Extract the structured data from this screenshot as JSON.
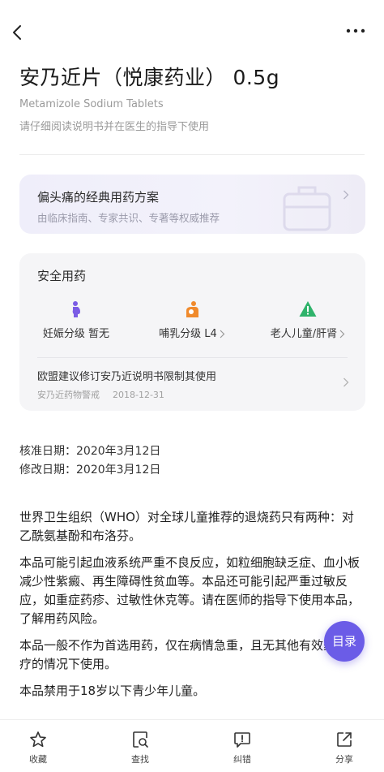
{
  "header": {
    "back_icon": "chevron-left-icon",
    "more_icon": "more-dots-icon"
  },
  "drug": {
    "title": "安乃近片（悦康药业） 0.5g",
    "english_name": "Metamizole Sodium Tablets",
    "instruction": "请仔细阅读说明书并在医生的指导下使用"
  },
  "migraine_card": {
    "title": "偏头痛的经典用药方案",
    "desc": "由临床指南、专家共识、专著等权威推荐"
  },
  "safety": {
    "title": "安全用药",
    "items": [
      {
        "label": "妊娠分级 暂无",
        "icon": "pregnancy-icon",
        "color": "#7b5ce5"
      },
      {
        "label": "哺乳分级 L4",
        "icon": "breastfeeding-icon",
        "color": "#f08a2c"
      },
      {
        "label": "老人儿童/肝肾",
        "icon": "warning-triangle-icon",
        "color": "#2fb36b"
      }
    ],
    "warning": {
      "title": "欧盟建议修订安乃近说明书限制其使用",
      "source": "安乃近药物警戒",
      "date": "2018-12-31"
    }
  },
  "dates": {
    "approved": "核准日期：2020年3月12日",
    "revised": "修改日期：2020年3月12日"
  },
  "content": {
    "paragraphs": [
      "世界卫生组织（WHO）对全球儿童推荐的退烧药只有两种：对乙酰氨基酚和布洛芬。",
      "本品可能引起血液系统严重不良反应，如粒细胞缺乏症、血小板减少性紫癜、再生障碍性贫血等。本品还可能引起严重过敏反应，如重症药疹、过敏性休克等。请在医师的指导下使用本品，了解用药风险。",
      "本品一般不作为首选用药，仅在病情急重，且无其他有效药品治疗的情况下使用。",
      "本品禁用于18岁以下青少年儿童。"
    ]
  },
  "toc_button": {
    "label": "目录",
    "color": "#6b5ce7"
  },
  "bottom_bar": {
    "tabs": [
      {
        "label": "收藏",
        "icon": "star-icon"
      },
      {
        "label": "查找",
        "icon": "search-doc-icon"
      },
      {
        "label": "纠错",
        "icon": "feedback-icon"
      },
      {
        "label": "分享",
        "icon": "share-icon"
      }
    ]
  }
}
